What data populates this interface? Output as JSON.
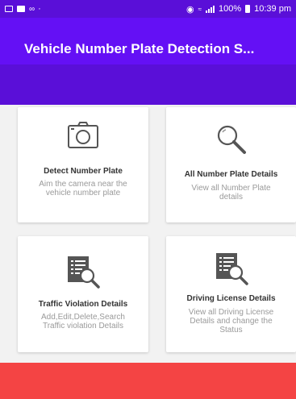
{
  "status_bar": {
    "battery": "100%",
    "time": "10:39 pm",
    "icons": [
      "gallery-icon",
      "message-icon",
      "dots-icon",
      "alarm-icon",
      "wifi-icon",
      "signal-icon",
      "battery-icon"
    ]
  },
  "app_bar": {
    "title": "Vehicle Number Plate Detection S..."
  },
  "cards": [
    {
      "icon": "camera-icon",
      "title": "Detect Number Plate",
      "desc": "Aim the camera near the vehicle number plate"
    },
    {
      "icon": "search-icon",
      "title": "All Number Plate Details",
      "desc": "View all Number Plate details"
    },
    {
      "icon": "document-search-icon",
      "title": "Traffic Violation Details",
      "desc": "Add,Edit,Delete,Search Traffic violation Details"
    },
    {
      "icon": "document-search-icon",
      "title": "Driving License Details",
      "desc": "View all Driving License Details and change the Status"
    }
  ],
  "colors": {
    "status_bar": "#5a0fd8",
    "app_bar": "#6410f5",
    "bottom_bar": "#f44444",
    "background": "#f2f2f2"
  }
}
